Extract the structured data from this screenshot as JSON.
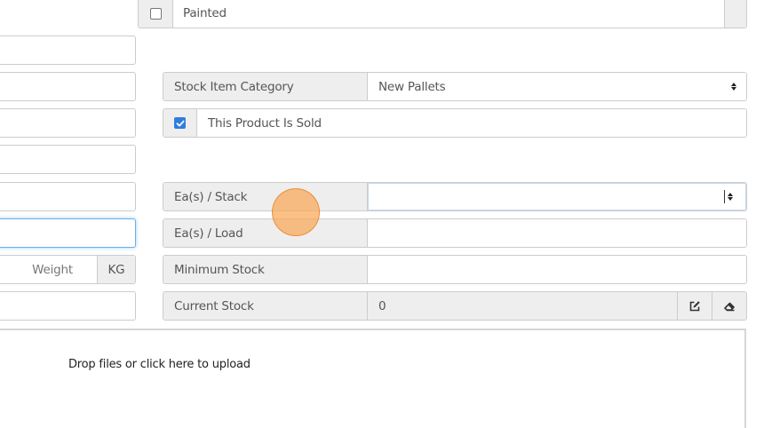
{
  "painted": {
    "label": "Painted",
    "checked": false
  },
  "stock_item_category": {
    "label": "Stock Item Category",
    "value": "New Pallets"
  },
  "product_sold": {
    "label": "This Product Is Sold",
    "checked": true
  },
  "ea_stack": {
    "label": "Ea(s) / Stack",
    "value": ""
  },
  "ea_load": {
    "label": "Ea(s) / Load",
    "value": ""
  },
  "minimum_stock": {
    "label": "Minimum Stock",
    "value": ""
  },
  "current_stock": {
    "label": "Current Stock",
    "value": "0",
    "edit_icon": "edit-icon",
    "clear_icon": "eraser-icon"
  },
  "weight": {
    "placeholder": "Weight",
    "unit": "KG"
  },
  "dropzone": {
    "text": "Drop files or click here to upload"
  },
  "colors": {
    "checkbox_accent": "#2f7dde",
    "focus_border": "#66afe9",
    "addon_bg": "#eeeeee",
    "cursor_highlight": "#f9a857"
  }
}
